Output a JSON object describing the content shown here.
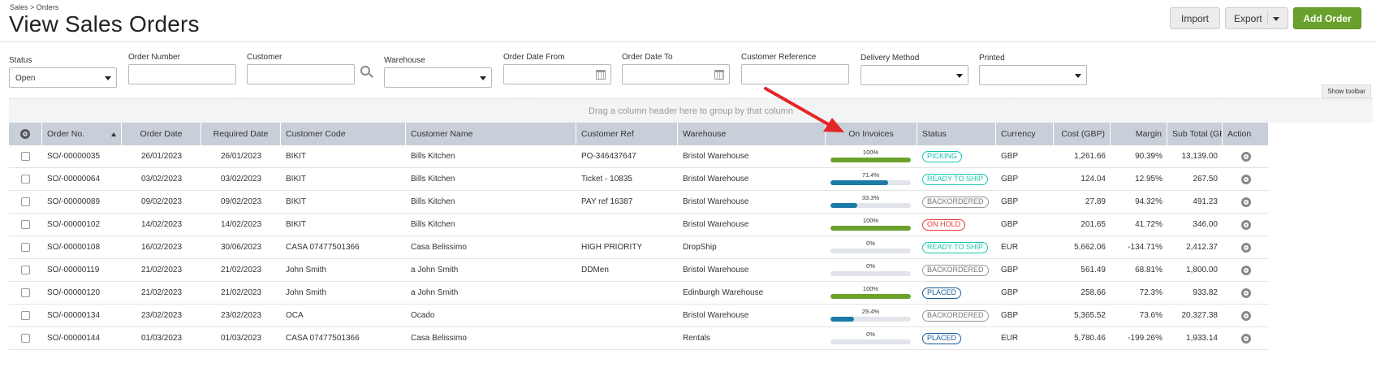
{
  "header": {
    "breadcrumb": "Sales > Orders",
    "title": "View Sales Orders",
    "import_label": "Import",
    "export_label": "Export",
    "add_label": "Add Order"
  },
  "filters": {
    "status_label": "Status",
    "status_value": "Open",
    "order_number_label": "Order Number",
    "customer_label": "Customer",
    "warehouse_label": "Warehouse",
    "date_from_label": "Order Date From",
    "date_to_label": "Order Date To",
    "customer_ref_label": "Customer Reference",
    "delivery_label": "Delivery Method",
    "printed_label": "Printed"
  },
  "toolbar": {
    "show_toolbar": "Show toolbar",
    "group_hint": "Drag a column header here to group by that column"
  },
  "columns": [
    "Order No.",
    "Order Date",
    "Required Date",
    "Customer Code",
    "Customer Name",
    "Customer Ref",
    "Warehouse",
    "On Invoices",
    "Status",
    "Currency",
    "Cost (GBP)",
    "Margin",
    "Sub Total (GB",
    "Action"
  ],
  "colors": {
    "green": "#6aa12c",
    "blue": "#1a7aa8",
    "teal": "#1bc5b0",
    "red": "#e53935",
    "arrow": "#e32626"
  },
  "rows": [
    {
      "order_no": "SO/-00000035",
      "order_date": "26/01/2023",
      "required_date": "26/01/2023",
      "customer_code": "BIKIT",
      "customer_name": "Bills Kitchen",
      "customer_ref": "PO-346437647",
      "warehouse": "Bristol Warehouse",
      "invoiced_pct": "100%",
      "invoiced": 100,
      "status": "PICKING",
      "status_style": "teal",
      "currency": "GBP",
      "cost": "1,261.66",
      "margin": "90.39%",
      "subtotal": "13,139.00"
    },
    {
      "order_no": "SO/-00000064",
      "order_date": "03/02/2023",
      "required_date": "03/02/2023",
      "customer_code": "BIKIT",
      "customer_name": "Bills Kitchen",
      "customer_ref": "Ticket - 10835",
      "warehouse": "Bristol Warehouse",
      "invoiced_pct": "71.4%",
      "invoiced": 71.4,
      "status": "READY TO SHIP",
      "status_style": "teal",
      "currency": "GBP",
      "cost": "124.04",
      "margin": "12.95%",
      "subtotal": "267.50"
    },
    {
      "order_no": "SO/-00000089",
      "order_date": "09/02/2023",
      "required_date": "09/02/2023",
      "customer_code": "BIKIT",
      "customer_name": "Bills Kitchen",
      "customer_ref": "PAY ref 16387",
      "warehouse": "Bristol Warehouse",
      "invoiced_pct": "33.3%",
      "invoiced": 33.3,
      "status": "BACKORDERED",
      "status_style": "grey",
      "currency": "GBP",
      "cost": "27.89",
      "margin": "94.32%",
      "subtotal": "491.23"
    },
    {
      "order_no": "SO/-00000102",
      "order_date": "14/02/2023",
      "required_date": "14/02/2023",
      "customer_code": "BIKIT",
      "customer_name": "Bills Kitchen",
      "customer_ref": "",
      "warehouse": "Bristol Warehouse",
      "invoiced_pct": "100%",
      "invoiced": 100,
      "status": "ON HOLD",
      "status_style": "red",
      "currency": "GBP",
      "cost": "201.65",
      "margin": "41.72%",
      "subtotal": "346.00"
    },
    {
      "order_no": "SO/-00000108",
      "order_date": "16/02/2023",
      "required_date": "30/06/2023",
      "customer_code": "CASA 07477501366",
      "customer_name": "Casa Belissimo",
      "customer_ref": "HIGH PRIORITY",
      "warehouse": "DropShip",
      "invoiced_pct": "0%",
      "invoiced": 0,
      "status": "READY TO SHIP",
      "status_style": "teal",
      "currency": "EUR",
      "cost": "5,662.06",
      "margin": "-134.71%",
      "subtotal": "2,412.37"
    },
    {
      "order_no": "SO/-00000119",
      "order_date": "21/02/2023",
      "required_date": "21/02/2023",
      "customer_code": "John Smith",
      "customer_name": "a John Smith",
      "customer_ref": "DDMen",
      "warehouse": "Bristol Warehouse",
      "invoiced_pct": "0%",
      "invoiced": 0,
      "status": "BACKORDERED",
      "status_style": "grey",
      "currency": "GBP",
      "cost": "561.49",
      "margin": "68.81%",
      "subtotal": "1,800.00"
    },
    {
      "order_no": "SO/-00000120",
      "order_date": "21/02/2023",
      "required_date": "21/02/2023",
      "customer_code": "John Smith",
      "customer_name": "a John Smith",
      "customer_ref": "",
      "warehouse": "Edinburgh Warehouse",
      "invoiced_pct": "100%",
      "invoiced": 100,
      "status": "PLACED",
      "status_style": "blue",
      "currency": "GBP",
      "cost": "258.66",
      "margin": "72.3%",
      "subtotal": "933.82"
    },
    {
      "order_no": "SO/-00000134",
      "order_date": "23/02/2023",
      "required_date": "23/02/2023",
      "customer_code": "OCA",
      "customer_name": "Ocado",
      "customer_ref": "",
      "warehouse": "Bristol Warehouse",
      "invoiced_pct": "29.4%",
      "invoiced": 29.4,
      "status": "BACKORDERED",
      "status_style": "grey",
      "currency": "GBP",
      "cost": "5,365.52",
      "margin": "73.6%",
      "subtotal": "20,327.38"
    },
    {
      "order_no": "SO/-00000144",
      "order_date": "01/03/2023",
      "required_date": "01/03/2023",
      "customer_code": "CASA 07477501366",
      "customer_name": "Casa Belissimo",
      "customer_ref": "",
      "warehouse": "Rentals",
      "invoiced_pct": "0%",
      "invoiced": 0,
      "status": "PLACED",
      "status_style": "blue",
      "currency": "EUR",
      "cost": "5,780.46",
      "margin": "-199.26%",
      "subtotal": "1,933.14"
    }
  ]
}
